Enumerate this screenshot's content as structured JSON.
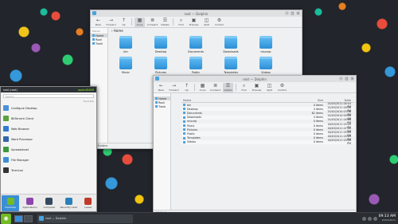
{
  "window1": {
    "title": "root — Dolphin",
    "toolbar": [
      {
        "label": "Back",
        "icon": "back-icon"
      },
      {
        "label": "Forward",
        "icon": "forward-icon"
      },
      {
        "label": "Up",
        "icon": "up-icon"
      },
      {
        "label": "Icons",
        "icon": "icons-view-icon",
        "active": true
      },
      {
        "label": "Compact",
        "icon": "compact-view-icon"
      },
      {
        "label": "Details",
        "icon": "details-view-icon"
      },
      {
        "label": "Find",
        "icon": "find-icon"
      },
      {
        "label": "Preview",
        "icon": "preview-icon"
      },
      {
        "label": "Split",
        "icon": "split-icon"
      },
      {
        "label": "Control",
        "icon": "control-icon"
      }
    ],
    "places_header": "Places",
    "places": [
      {
        "label": "Home",
        "selected": true
      },
      {
        "label": "Root"
      },
      {
        "label": "Trash"
      }
    ],
    "breadcrumb": "› Home",
    "items": [
      "bin",
      "Desktop",
      "Documents",
      "Downloads",
      "mscorp",
      "Music",
      "Pictures",
      "Public",
      "Templates",
      "Videos"
    ],
    "status": "10 Folders"
  },
  "window2": {
    "title": "root — Dolphin",
    "toolbar": [
      {
        "label": "Back",
        "icon": "back-icon"
      },
      {
        "label": "Forward",
        "icon": "forward-icon"
      },
      {
        "label": "Up",
        "icon": "up-icon"
      },
      {
        "label": "Icons",
        "icon": "icons-view-icon"
      },
      {
        "label": "Compact",
        "icon": "compact-view-icon"
      },
      {
        "label": "Details",
        "icon": "details-view-icon",
        "active": true
      },
      {
        "label": "Find",
        "icon": "find-icon"
      },
      {
        "label": "Preview",
        "icon": "preview-icon"
      },
      {
        "label": "Split",
        "icon": "split-icon"
      },
      {
        "label": "Control",
        "icon": "control-icon"
      }
    ],
    "places": [
      {
        "label": "Home",
        "selected": true
      },
      {
        "label": "Root"
      },
      {
        "label": "Trash"
      }
    ],
    "columns": {
      "name": "Name",
      "size": "Size",
      "date": "Date"
    },
    "rows": [
      {
        "name": "bin",
        "size": "0 items",
        "date": "24/03/2011 00:54 PM"
      },
      {
        "name": "Desktop",
        "size": "4 items",
        "date": "24/03/2011 00:59 PM"
      },
      {
        "name": "Documents",
        "size": "62 items",
        "date": "25/02/2010 03:46 PM"
      },
      {
        "name": "Downloads",
        "size": "4 items",
        "date": "24/03/2010 00:00 AM"
      },
      {
        "name": "mscorp",
        "size": "0 items",
        "date": "24/03/2011 04:48 PM"
      },
      {
        "name": "Music",
        "size": "0 items",
        "date": "16/03/2011 05:09 PM"
      },
      {
        "name": "Pictures",
        "size": "0 items",
        "date": "16/03/2011 07:41 PM"
      },
      {
        "name": "Public",
        "size": "0 items",
        "date": "16/03/2011 05:09 PM"
      },
      {
        "name": "Templates",
        "size": "0 items",
        "date": "16/03/2011 05:09 PM"
      },
      {
        "name": "Videos",
        "size": "0 items",
        "date": "16/03/2011 05:09 PM"
      }
    ],
    "status": "10 Folders"
  },
  "launcher": {
    "user": "root (root)",
    "brand": "openSUSE",
    "search_placeholder": "Search:",
    "favorites_header": "Favorites",
    "items": [
      {
        "label": "Configure Desktop",
        "color": "#4a90d9"
      },
      {
        "label": "BitTorrent Client",
        "color": "#5aa33a"
      },
      {
        "label": "Web Browser",
        "color": "#2e7bcf"
      },
      {
        "label": "Word Processor",
        "color": "#3466a8"
      },
      {
        "label": "Spreadsheet",
        "color": "#3c9a3c"
      },
      {
        "label": "File Manager",
        "color": "#3a8ed6"
      },
      {
        "label": "Terminal",
        "color": "#333333"
      }
    ],
    "tabs": [
      {
        "label": "Favorites",
        "color": "#73ba25",
        "selected": true
      },
      {
        "label": "Applications",
        "color": "#8e44ad"
      },
      {
        "label": "Computer",
        "color": "#34495e"
      },
      {
        "label": "Recently Used",
        "color": "#2980b9"
      },
      {
        "label": "Leave",
        "color": "#c0392b"
      }
    ]
  },
  "taskbar": {
    "task_label": "root — Dolphin",
    "time": "09:13 AM",
    "date": "24/03/2011"
  }
}
